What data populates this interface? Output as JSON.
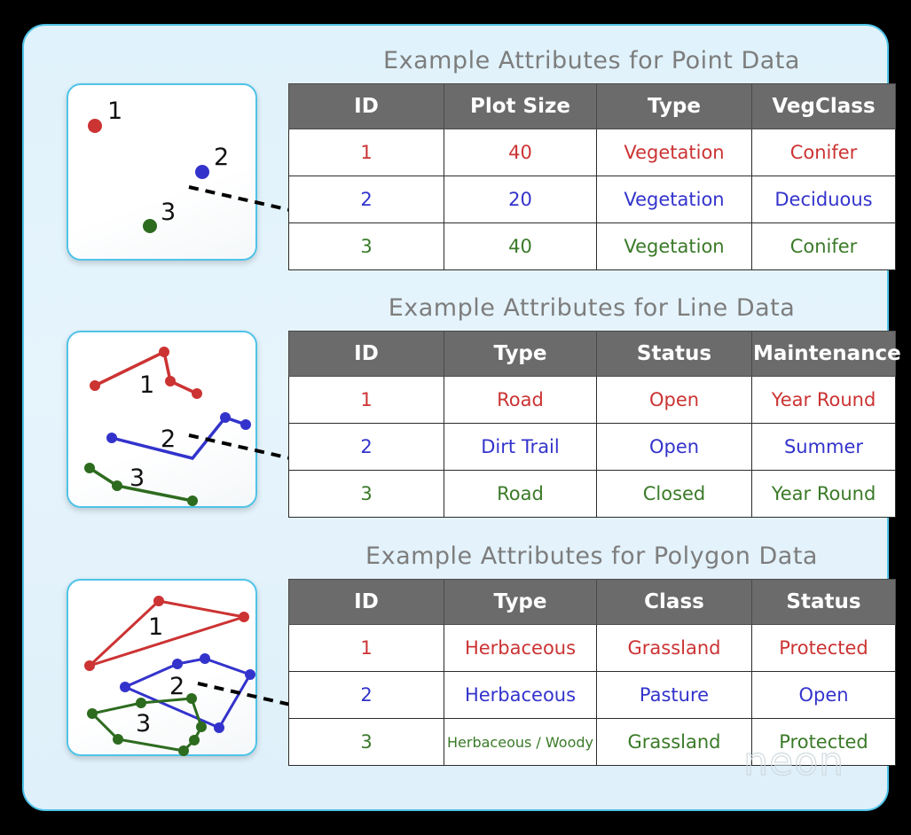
{
  "colors": {
    "background": "#000000",
    "card_fill": "#e2f3fb",
    "card_border": "#4fc3e8",
    "header_gray": "#6b6b6b",
    "title_gray": "#7d7d7d",
    "row_red": "#cc3333",
    "row_blue": "#3333cc",
    "row_green": "#3a7a28",
    "arrow": "#000000"
  },
  "logo": {
    "text": "neon"
  },
  "sections": [
    {
      "id": "point",
      "title": "Example Attributes for Point Data",
      "panel_name": "point-data-map",
      "headers": [
        "ID",
        "Plot Size",
        "Type",
        "VegClass"
      ],
      "rows": [
        {
          "color": "red",
          "cells": [
            "1",
            "40",
            "Vegetation",
            "Conifer"
          ]
        },
        {
          "color": "blue",
          "cells": [
            "2",
            "20",
            "Vegetation",
            "Deciduous"
          ]
        },
        {
          "color": "green",
          "cells": [
            "3",
            "40",
            "Vegetation",
            "Conifer"
          ]
        }
      ],
      "features": [
        {
          "label": "1",
          "color": "red"
        },
        {
          "label": "2",
          "color": "blue"
        },
        {
          "label": "3",
          "color": "green"
        }
      ]
    },
    {
      "id": "line",
      "title": "Example Attributes for Line Data",
      "panel_name": "line-data-map",
      "headers": [
        "ID",
        "Type",
        "Status",
        "Maintenance"
      ],
      "rows": [
        {
          "color": "red",
          "cells": [
            "1",
            "Road",
            "Open",
            "Year Round"
          ]
        },
        {
          "color": "blue",
          "cells": [
            "2",
            "Dirt Trail",
            "Open",
            "Summer"
          ]
        },
        {
          "color": "green",
          "cells": [
            "3",
            "Road",
            "Closed",
            "Year Round"
          ]
        }
      ],
      "features": [
        {
          "label": "1",
          "color": "red"
        },
        {
          "label": "2",
          "color": "blue"
        },
        {
          "label": "3",
          "color": "green"
        }
      ]
    },
    {
      "id": "polygon",
      "title": "Example Attributes for Polygon Data",
      "panel_name": "polygon-data-map",
      "headers": [
        "ID",
        "Type",
        "Class",
        "Status"
      ],
      "rows": [
        {
          "color": "red",
          "cells": [
            "1",
            "Herbaceous",
            "Grassland",
            "Protected"
          ]
        },
        {
          "color": "blue",
          "cells": [
            "2",
            "Herbaceous",
            "Pasture",
            "Open"
          ]
        },
        {
          "color": "green",
          "cells": [
            "3",
            "Herbaceous / Woody",
            "Grassland",
            "Protected"
          ]
        }
      ],
      "features": [
        {
          "label": "1",
          "color": "red"
        },
        {
          "label": "2",
          "color": "blue"
        },
        {
          "label": "3",
          "color": "green"
        }
      ]
    }
  ]
}
